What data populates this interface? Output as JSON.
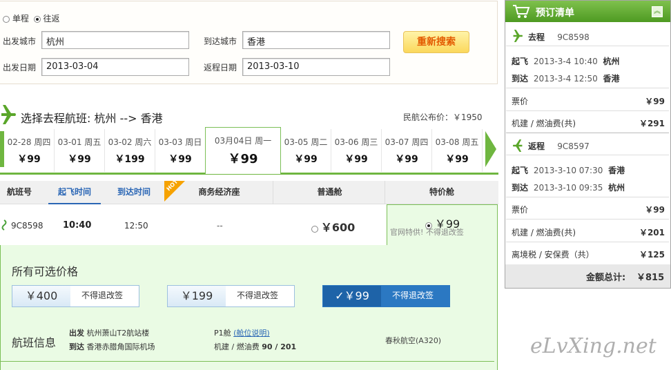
{
  "search": {
    "trip_oneway": "单程",
    "trip_round": "往返",
    "depart_city_label": "出发城市",
    "depart_city": "杭州",
    "arrive_city_label": "到达城市",
    "arrive_city": "香港",
    "depart_date_label": "出发日期",
    "depart_date": "2013-03-04",
    "return_date_label": "返程日期",
    "return_date": "2013-03-10",
    "research_label": "重新搜索"
  },
  "heading": {
    "title": "选择去程航班: 杭州 --> 香港",
    "public_price_label": "民航公布价：",
    "public_price": "￥1950"
  },
  "dates": [
    {
      "date": "02-28 周四",
      "price": "￥99"
    },
    {
      "date": "03-01 周五",
      "price": "￥99"
    },
    {
      "date": "03-02 周六",
      "price": "￥199"
    },
    {
      "date": "03-03 周日",
      "price": "￥99"
    },
    {
      "date": "03月04日 周一",
      "price": "￥99"
    },
    {
      "date": "03-05 周二",
      "price": "￥99"
    },
    {
      "date": "03-06 周三",
      "price": "￥99"
    },
    {
      "date": "03-07 周四",
      "price": "￥99"
    },
    {
      "date": "03-08 周五",
      "price": "￥99"
    }
  ],
  "table": {
    "headers": [
      "航班号",
      "起飞时间",
      "到达时间",
      "商务经济座",
      "普通舱",
      "特价舱"
    ],
    "hot": "HOT",
    "row": {
      "flight_no": "9C8598",
      "depart": "10:40",
      "arrive": "12:50",
      "business": "--",
      "economy": "￥600",
      "special": "￥99",
      "special_note": "官网特供! 不得退改签"
    }
  },
  "prices": {
    "title": "所有可选价格",
    "options": [
      {
        "price": "￥400",
        "note": "不得退改签"
      },
      {
        "price": "￥199",
        "note": "不得退改签"
      },
      {
        "price": "￥99",
        "note": "不得退改签"
      }
    ]
  },
  "flight_info": {
    "title": "航班信息",
    "depart_label": "出发",
    "depart_airport": "杭州萧山T2航站楼",
    "arrive_label": "到达",
    "arrive_airport": "香港赤腊角国际机场",
    "cabin": "P1舱",
    "cabin_link": "(舱位说明)",
    "tax_label": "机建 / 燃油费",
    "tax_value": "90 / 201",
    "airline": "春秋航空(A320)"
  },
  "order": {
    "title": "预订清单",
    "outbound": {
      "label": "去程",
      "flight": "9C8598",
      "takeoff_label": "起飞",
      "takeoff": "2013-3-4 10:40",
      "takeoff_city": "杭州",
      "arrive_label": "到达",
      "arrive": "2013-3-4 12:50",
      "arrive_city": "香港",
      "ticket_label": "票价",
      "ticket": "￥99",
      "tax_label": "机建 / 燃油费(共)",
      "tax": "￥291"
    },
    "return": {
      "label": "返程",
      "flight": "9C8597",
      "takeoff_label": "起飞",
      "takeoff": "2013-3-10 07:30",
      "takeoff_city": "香港",
      "arrive_label": "到达",
      "arrive": "2013-3-10 09:35",
      "arrive_city": "杭州",
      "ticket_label": "票价",
      "ticket": "￥99",
      "tax_label": "机建 / 燃油费(共)",
      "tax": "￥201",
      "exit_tax_label": "离境税 / 安保费（共）",
      "exit_tax": "￥125"
    },
    "total_label": "金额总计:",
    "total": "￥815"
  },
  "watermark": "eLvXing.net",
  "colors": {
    "green": "#6fb640",
    "blue": "#2a66b5",
    "orange": "#e35a00"
  }
}
